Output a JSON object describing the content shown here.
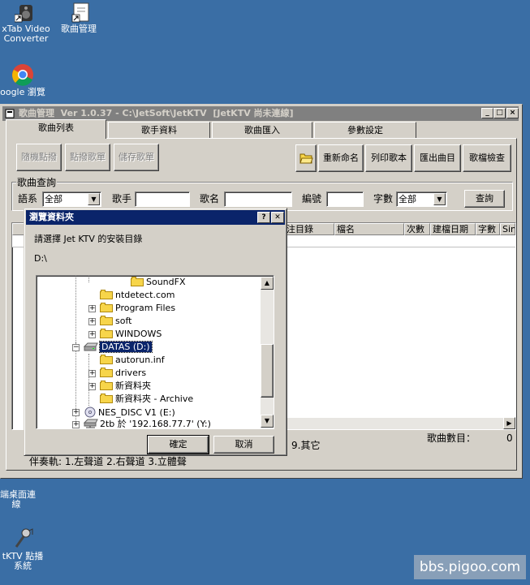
{
  "desktop": {
    "icons": [
      {
        "label1": "xTab Video",
        "label2": "Converter",
        "icon": "speaker-shortcut-icon"
      },
      {
        "label1": "歌曲管理",
        "label2": "",
        "icon": "app-shortcut-icon"
      },
      {
        "label1": "oogle 瀏覽",
        "label2": "",
        "icon": "chrome-icon"
      },
      {
        "label1": "端桌面連",
        "label2": "線",
        "icon": "remote-desktop-icon"
      },
      {
        "label1": "tKTV 點播",
        "label2": "系統",
        "icon": "karaoke-shortcut-icon"
      }
    ],
    "watermark": "bbs.pigoo.com"
  },
  "main_window": {
    "title": "歌曲管理  Ver 1.0.37 - C:\\JetSoft\\JetKTV  [JetKTV 尚未連線]",
    "tabs": [
      "歌曲列表",
      "歌手資料",
      "歌曲匯入",
      "參數設定"
    ],
    "left_buttons": [
      "隨機點撥",
      "點撥歌單",
      "儲存歌單"
    ],
    "right_buttons": [
      "重新命名",
      "列印歌本",
      "匯出曲目",
      "歌檔檢查"
    ],
    "query": {
      "group_label": "歌曲查詢",
      "lang_label": "語系",
      "lang_value": "全部",
      "singer_label": "歌手",
      "song_label": "歌名",
      "number_label": "編號",
      "count_label": "字數",
      "count_value": "全部",
      "query_button": "查詢"
    },
    "columns": [
      "注目錄",
      "檔名",
      "次數",
      "建檔日期",
      "字數",
      "Sin"
    ],
    "footer_text": "9.其它",
    "song_count_label": "歌曲數目：",
    "song_count_value": "0",
    "bottom_text": "伴奏軌: 1.左聲道 2.右聲道 3.立體聲"
  },
  "dialog": {
    "title": "瀏覽資料夾",
    "prompt": "請選擇 Jet KTV 的安裝目錄",
    "path": "D:\\",
    "tree": [
      {
        "label": "SoundFX",
        "type": "folder",
        "expand": false
      },
      {
        "label": "ntdetect.com",
        "type": "file",
        "expand": false
      },
      {
        "label": "Program Files",
        "type": "folder",
        "expand": true
      },
      {
        "label": "soft",
        "type": "folder",
        "expand": true
      },
      {
        "label": "WINDOWS",
        "type": "folder",
        "expand": true
      },
      {
        "label": "DATAS (D:)",
        "type": "drive",
        "expand": true
      },
      {
        "label": "autorun.inf",
        "type": "file",
        "expand": false
      },
      {
        "label": "drivers",
        "type": "folder",
        "expand": true
      },
      {
        "label": "新資料夾",
        "type": "folder",
        "expand": true
      },
      {
        "label": "新資料夾 - Archive",
        "type": "folder",
        "expand": false
      },
      {
        "label": "NES_DISC V1 (E:)",
        "type": "cd",
        "expand": true
      },
      {
        "label": "2tb 於 '192.168.77.7' (Y:)",
        "type": "net",
        "expand": true
      }
    ],
    "ok_button": "確定",
    "cancel_button": "取消",
    "help_button": "?",
    "close_button": "✕"
  }
}
